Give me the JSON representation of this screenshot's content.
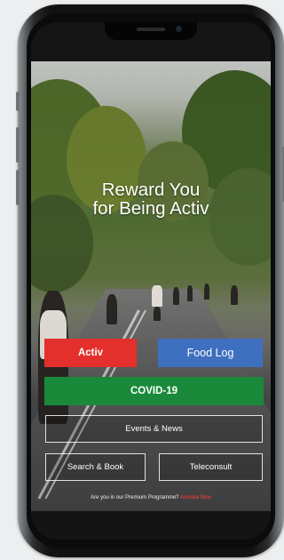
{
  "headline": {
    "line1": "Reward You",
    "line2": "for Being Activ"
  },
  "buttons": {
    "activ": "Activ",
    "food_log": "Food Log",
    "covid": "COVID-19",
    "events_news": "Events & News",
    "search_book": "Search & Book",
    "teleconsult": "Teleconsult"
  },
  "footer": {
    "question": "Are you in our Premium Programme?",
    "link": "Activate Now"
  },
  "colors": {
    "activ": "#e3302c",
    "food_log": "#3f6fbf",
    "covid": "#1a8a3a"
  }
}
